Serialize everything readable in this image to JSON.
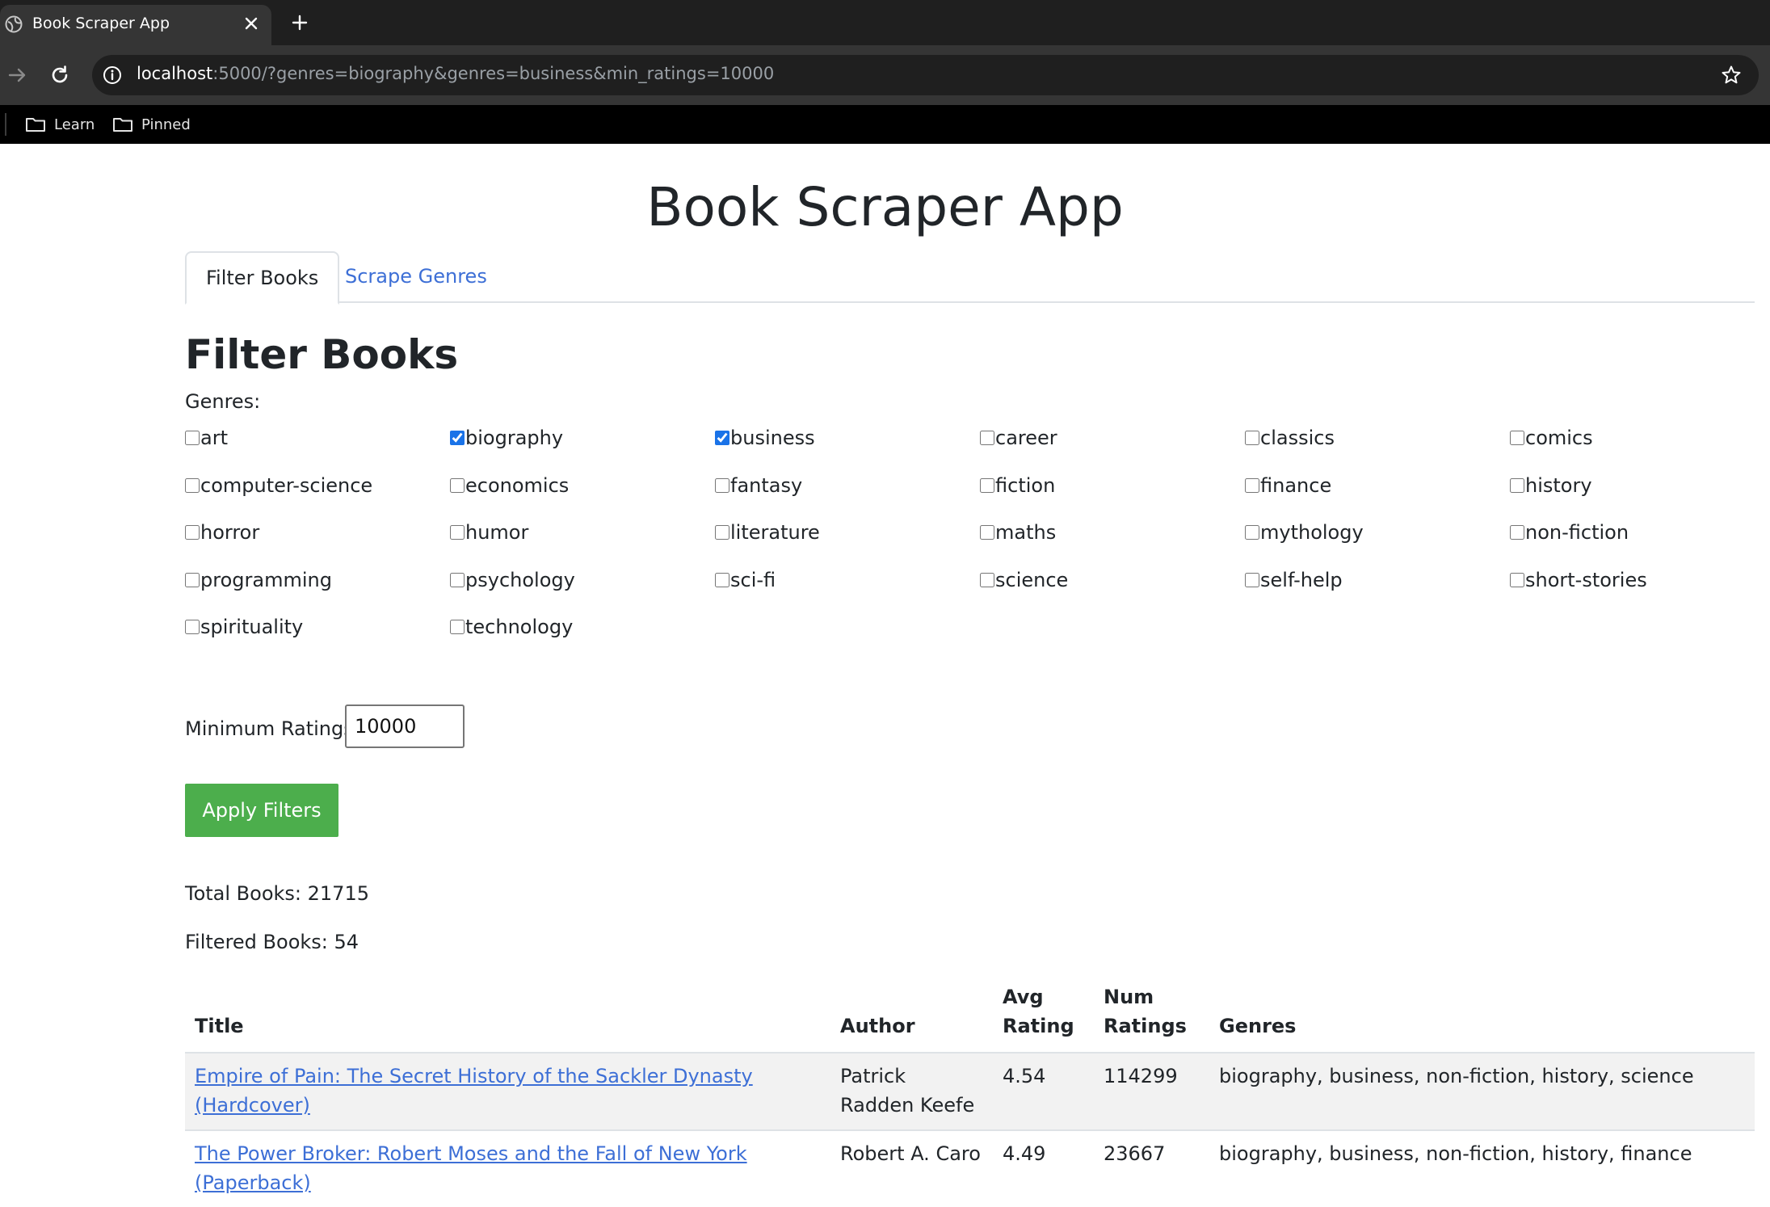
{
  "browser": {
    "tab_title": "Book Scraper App",
    "url_host": "localhost",
    "url_rest": ":5000/?genres=biography&genres=business&min_ratings=10000",
    "bookmarks": [
      {
        "label": "Learn",
        "icon": "folder-icon"
      },
      {
        "label": "Pinned",
        "icon": "folder-icon"
      }
    ]
  },
  "page": {
    "title": "Book Scraper App",
    "tabs": [
      {
        "label": "Filter Books",
        "active": true
      },
      {
        "label": "Scrape Genres",
        "active": false
      }
    ],
    "section_heading": "Filter Books",
    "genres_label": "Genres:",
    "genres": [
      {
        "name": "art",
        "checked": false
      },
      {
        "name": "biography",
        "checked": true
      },
      {
        "name": "business",
        "checked": true
      },
      {
        "name": "career",
        "checked": false
      },
      {
        "name": "classics",
        "checked": false
      },
      {
        "name": "comics",
        "checked": false
      },
      {
        "name": "computer-science",
        "checked": false
      },
      {
        "name": "economics",
        "checked": false
      },
      {
        "name": "fantasy",
        "checked": false
      },
      {
        "name": "fiction",
        "checked": false
      },
      {
        "name": "finance",
        "checked": false
      },
      {
        "name": "history",
        "checked": false
      },
      {
        "name": "horror",
        "checked": false
      },
      {
        "name": "humor",
        "checked": false
      },
      {
        "name": "literature",
        "checked": false
      },
      {
        "name": "maths",
        "checked": false
      },
      {
        "name": "mythology",
        "checked": false
      },
      {
        "name": "non-fiction",
        "checked": false
      },
      {
        "name": "programming",
        "checked": false
      },
      {
        "name": "psychology",
        "checked": false
      },
      {
        "name": "sci-fi",
        "checked": false
      },
      {
        "name": "science",
        "checked": false
      },
      {
        "name": "self-help",
        "checked": false
      },
      {
        "name": "short-stories",
        "checked": false
      },
      {
        "name": "spirituality",
        "checked": false
      },
      {
        "name": "technology",
        "checked": false
      }
    ],
    "min_ratings_label": "Minimum Ratings:",
    "min_ratings_value": "10000",
    "apply_button": "Apply Filters",
    "total_books": "Total Books: 21715",
    "filtered_books": "Filtered Books: 54",
    "table": {
      "headers": [
        "Title",
        "Author",
        "Avg Rating",
        "Num Ratings",
        "Genres"
      ],
      "rows": [
        {
          "title": "Empire of Pain: The Secret History of the Sackler Dynasty (Hardcover)",
          "author": "Patrick Radden Keefe",
          "avg_rating": "4.54",
          "num_ratings": "114299",
          "genres": "biography, business, non-fiction, history, science"
        },
        {
          "title": "The Power Broker: Robert Moses and the Fall of New York (Paperback)",
          "author": "Robert A. Caro",
          "avg_rating": "4.49",
          "num_ratings": "23667",
          "genres": "biography, business, non-fiction, history, finance"
        }
      ]
    }
  },
  "colors": {
    "accent_link": "#3d6fd6",
    "apply_button": "#4cae4c",
    "checkbox": "#1a73e8"
  }
}
